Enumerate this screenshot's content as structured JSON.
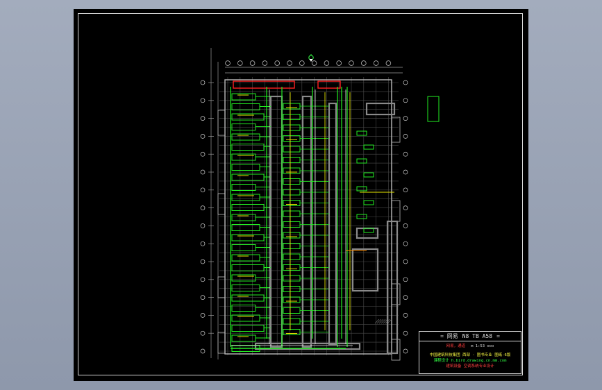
{
  "colors": {
    "background": "#000000",
    "frame": "#d8d8d8",
    "duct": "#8a8a8a",
    "pipe_green": "#22ee22",
    "pipe_yellow": "#e8e800",
    "pipe_white": "#e8e8e8",
    "accent_red": "#ff2020",
    "grid": "#4a4a4a"
  },
  "icons": {
    "north_arrow": "north-arrow-icon"
  },
  "title_block": {
    "header_left": "=  网易",
    "header_mid": "N8 TB A58",
    "header_right": "=",
    "name_line": "网易，通道",
    "scale_text": "m 1:53 ooo",
    "project_line": "中国建筑科技集团 西部 · 图书专业  图纸-6版",
    "designer_line": "课程设计  h.bird.drawing.cn.mm.com",
    "school_line": "建筑设备 空调系统专业设计"
  }
}
